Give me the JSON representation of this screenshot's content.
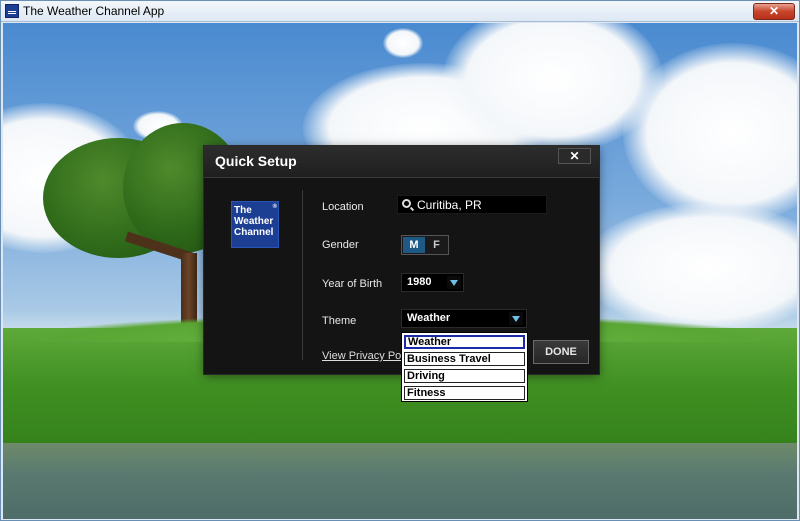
{
  "window": {
    "title": "The Weather Channel App",
    "close_glyph": "✕"
  },
  "dialog": {
    "title": "Quick Setup",
    "close_glyph": "✕",
    "logo": {
      "line1": "The",
      "line2": "Weather",
      "line3": "Channel",
      "mark": "®"
    },
    "location": {
      "label": "Location",
      "value": "Curitiba, PR",
      "icon": "search-icon"
    },
    "gender": {
      "label": "Gender",
      "options": [
        "M",
        "F"
      ],
      "selected": "M"
    },
    "year_of_birth": {
      "label": "Year of Birth",
      "value": "1980"
    },
    "theme": {
      "label": "Theme",
      "value": "Weather",
      "options": [
        "Weather",
        "Business Travel",
        "Driving",
        "Fitness"
      ],
      "highlighted": "Weather"
    },
    "privacy_link": "View Privacy Policy",
    "done_label": "DONE"
  },
  "colors": {
    "dialog_bg": "#141414",
    "accent_blue": "#1f5a86",
    "logo_blue": "#1c3f94",
    "dropdown_highlight": "#1a2aa8"
  }
}
